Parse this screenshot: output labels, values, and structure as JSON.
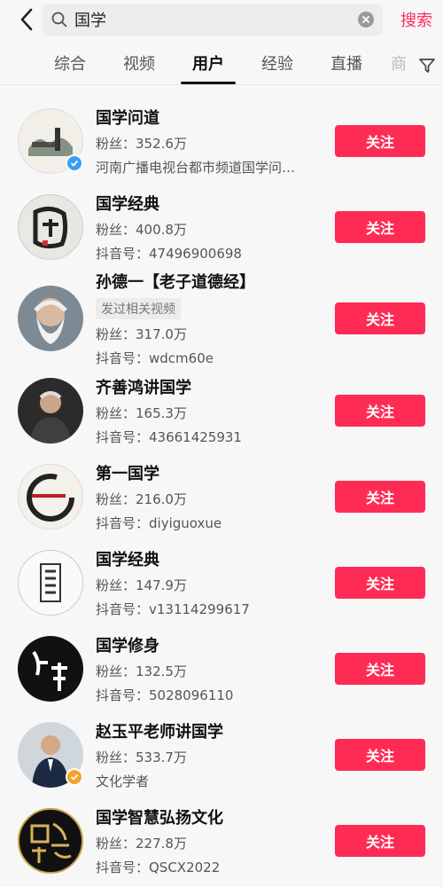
{
  "search": {
    "query": "国学",
    "button_label": "搜索"
  },
  "tabs": [
    {
      "label": "综合"
    },
    {
      "label": "视频"
    },
    {
      "label": "用户",
      "active": true
    },
    {
      "label": "经验"
    },
    {
      "label": "直播"
    },
    {
      "label": "商"
    }
  ],
  "icons": {
    "back": "back-arrow-icon",
    "search": "search-icon",
    "clear": "clear-icon",
    "filter": "filter-icon"
  },
  "colors": {
    "accent": "#fe2c55",
    "verified_blue": "#3c9cf0",
    "verified_gold": "#f3a42a"
  },
  "results": [
    {
      "name": "国学问道",
      "line1": "粉丝：352.6万",
      "line2": "河南广播电视台都市频道国学问…",
      "follow": "关注",
      "verified": "blue"
    },
    {
      "name": "国学经典",
      "line1": "粉丝：400.8万",
      "line2": "抖音号：47496900698",
      "follow": "关注"
    },
    {
      "name": "孙德一【老子道德经】",
      "chip": "发过相关视频",
      "line1": "粉丝：317.0万",
      "line2": "抖音号：wdcm60e",
      "follow": "关注"
    },
    {
      "name": "齐善鸿讲国学",
      "line1": "粉丝：165.3万",
      "line2": "抖音号：43661425931",
      "follow": "关注"
    },
    {
      "name": "第一国学",
      "line1": "粉丝：216.0万",
      "line2": "抖音号：diyiguoxue",
      "follow": "关注"
    },
    {
      "name": "国学经典",
      "line1": "粉丝：147.9万",
      "line2": "抖音号：v13114299617",
      "follow": "关注"
    },
    {
      "name": "国学修身",
      "line1": "粉丝：132.5万",
      "line2": "抖音号：5028096110",
      "follow": "关注"
    },
    {
      "name": "赵玉平老师讲国学",
      "line1": "粉丝：533.7万",
      "line2": "文化学者",
      "follow": "关注",
      "verified": "gold"
    },
    {
      "name": "国学智慧弘扬文化",
      "line1": "粉丝：227.8万",
      "line2": "抖音号：QSCX2022",
      "follow": "关注"
    }
  ]
}
